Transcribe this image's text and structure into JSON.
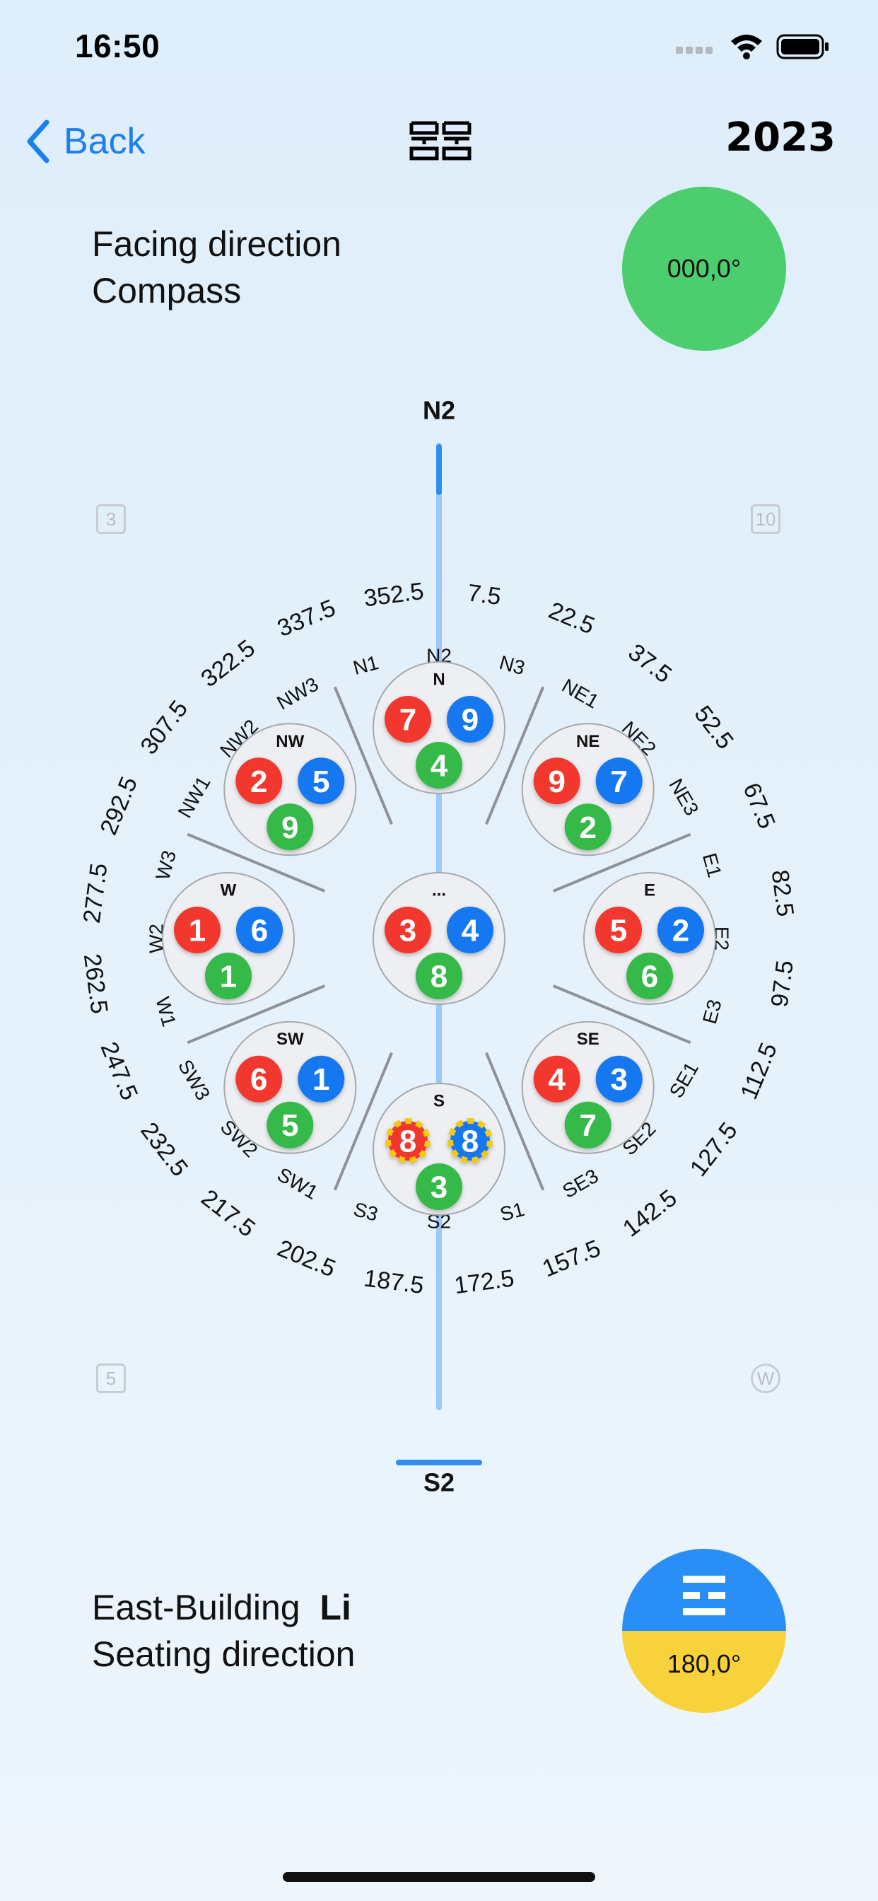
{
  "status_bar": {
    "time": "16:50"
  },
  "nav": {
    "back_label": "Back",
    "year": "2023",
    "title_icon": "double-trigram-icon"
  },
  "facing": {
    "line1": "Facing direction",
    "line2": "Compass",
    "value": "000,0°"
  },
  "seating": {
    "line1_prefix": "East-Building",
    "line1_bold": "Li",
    "line2": "Seating direction",
    "value": "180,0°",
    "trigram_icon": "li-trigram-icon"
  },
  "compass": {
    "north_label": "N2",
    "south_label": "S2",
    "corners": {
      "top_left": "3",
      "top_right": "10",
      "bottom_left": "5",
      "bottom_right": "W"
    },
    "degree_labels": [
      "7.5",
      "22.5",
      "37.5",
      "52.5",
      "67.5",
      "82.5",
      "97.5",
      "112.5",
      "127.5",
      "142.5",
      "157.5",
      "172.5",
      "187.5",
      "202.5",
      "217.5",
      "232.5",
      "247.5",
      "262.5",
      "277.5",
      "292.5",
      "307.5",
      "322.5",
      "337.5",
      "352.5"
    ],
    "mountain_labels": [
      "N2",
      "N3",
      "NE1",
      "NE2",
      "NE3",
      "E1",
      "E2",
      "E3",
      "SE1",
      "SE2",
      "SE3",
      "S1",
      "S2",
      "S3",
      "SW1",
      "SW2",
      "SW3",
      "W1",
      "W2",
      "W3",
      "NW1",
      "NW2",
      "NW3",
      "N1"
    ],
    "palaces": [
      {
        "label": "...",
        "mountain": "3",
        "water": "4",
        "period": "8"
      },
      {
        "label": "N",
        "mountain": "7",
        "water": "9",
        "period": "4"
      },
      {
        "label": "NE",
        "mountain": "9",
        "water": "7",
        "period": "2"
      },
      {
        "label": "E",
        "mountain": "5",
        "water": "2",
        "period": "6"
      },
      {
        "label": "SE",
        "mountain": "4",
        "water": "3",
        "period": "7"
      },
      {
        "label": "S",
        "mountain": "8",
        "water": "8",
        "period": "3",
        "special": true
      },
      {
        "label": "SW",
        "mountain": "6",
        "water": "1",
        "period": "5"
      },
      {
        "label": "W",
        "mountain": "1",
        "water": "6",
        "period": "1"
      },
      {
        "label": "NW",
        "mountain": "2",
        "water": "5",
        "period": "9"
      }
    ],
    "colors": {
      "mountain": "#f2392f",
      "water": "#1478f0",
      "period": "#35b94a",
      "axis": "#9ccaf5",
      "axis_marker": "#2f8ff0"
    }
  }
}
